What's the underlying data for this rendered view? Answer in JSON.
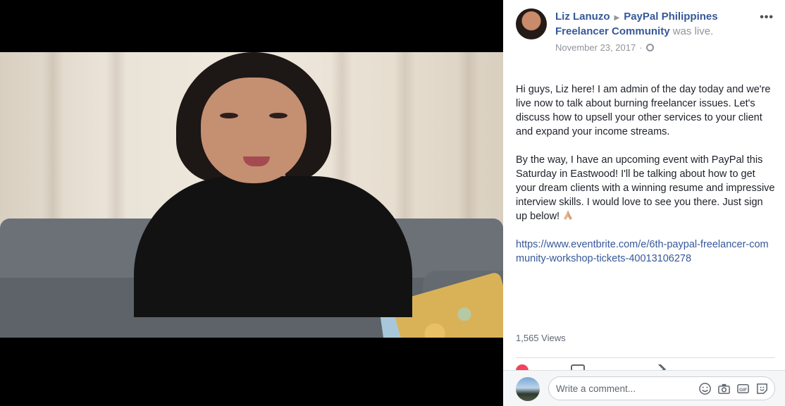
{
  "post": {
    "author": "Liz Lanuzo",
    "group": "PayPal Philippines Freelancer Community",
    "status": "was live.",
    "date": "November 23, 2017",
    "separator": "·",
    "more_label": "•••",
    "paragraph1": "Hi guys, Liz here! I am admin of the day today and we're live now to talk about burning freelancer issues. Let's discuss how to upsell your other services to your client and expand your income streams.",
    "paragraph2": "By the way, I have an upcoming event with PayPal this Saturday in Eastwood! I'll be talking about how to get your dream clients with a winning resume and impressive interview skills. I would love to see you there. Just sign up below!",
    "emoji": "praying-hands-icon",
    "link": "https://www.eventbrite.com/e/6th-paypal-freelancer-community-workshop-tickets-40013106278",
    "views": "1,565 Views"
  },
  "comment": {
    "placeholder": "Write a comment..."
  },
  "icons": {
    "emoji": "smiley-icon",
    "camera": "camera-icon",
    "gif": "gif-icon",
    "sticker": "sticker-icon"
  },
  "colors": {
    "link": "#365899",
    "meta": "#90949c",
    "text": "#1d2129"
  }
}
